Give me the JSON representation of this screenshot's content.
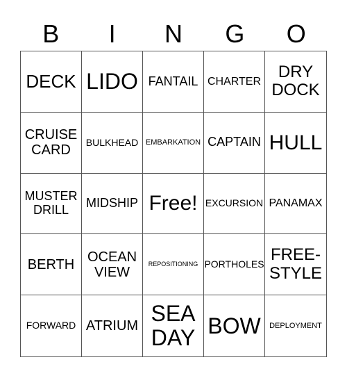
{
  "header": [
    "B",
    "I",
    "N",
    "G",
    "O"
  ],
  "cells": [
    [
      "DECK",
      "LIDO",
      "FANTAIL",
      "CHARTER",
      "DRY DOCK"
    ],
    [
      "CRUISE CARD",
      "BULKHEAD",
      "EMBARKATION",
      "CAPTAIN",
      "HULL"
    ],
    [
      "MUSTER DRILL",
      "MIDSHIP",
      "Free!",
      "EXCURSION",
      "PANAMAX"
    ],
    [
      "BERTH",
      "OCEAN VIEW",
      "REPOSITIONING",
      "PORTHOLES",
      "FREE-STYLE"
    ],
    [
      "FORWARD",
      "ATRIUM",
      "SEA DAY",
      "BOW",
      "DEPLOYMENT"
    ]
  ]
}
